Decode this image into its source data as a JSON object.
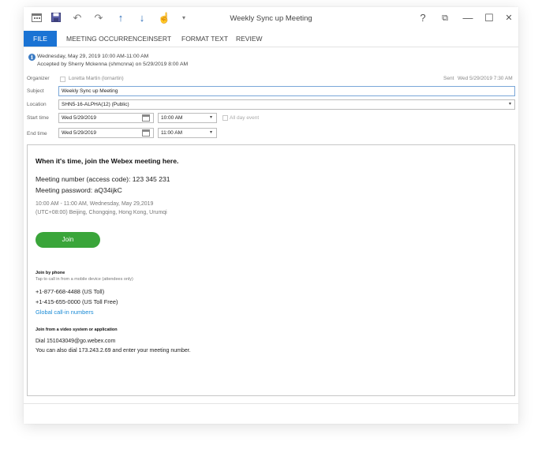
{
  "window": {
    "title": "Weekly Sync up Meeting"
  },
  "qat": {
    "icons": [
      "calendar-icon",
      "save-icon",
      "undo-icon",
      "redo-icon",
      "up-arrow-icon",
      "down-arrow-icon",
      "touch-mode-icon",
      "customize-icon"
    ]
  },
  "controls": {
    "help": "?",
    "ribbon_display": "⧉",
    "minimize": "—",
    "maximize": "☐",
    "close": "✕"
  },
  "ribbon": {
    "tabs": [
      "FILE",
      "MEETING OCCURRENCE",
      "INSERT",
      "FORMAT TEXT",
      "REVIEW"
    ],
    "accent": "#1a73d4"
  },
  "info": {
    "line1": "Wednesday, May 29, 2019 10:00 AM-11:00 AM",
    "line2": "Accepted by Sherry Mckenna (shmcnna) on 5/29/2019 8:00 AM"
  },
  "form": {
    "organizer_label": "Organizer",
    "organizer_value": "Loretta Martin (lornartin)",
    "sent_label": "Sent",
    "sent_value": "Wed 5/29/2019 7:30 AM",
    "subject_label": "Subject",
    "subject_value": "Weekly Sync up Meeting",
    "location_label": "Location",
    "location_value": "SHN5-16-ALPHA(12) (Public)",
    "start_label": "Start time",
    "start_date": "Wed 5/29/2019",
    "start_time": "10:00 AM",
    "all_day_label": "All day event",
    "end_label": "End time",
    "end_date": "Wed 5/29/2019",
    "end_time": "11:00 AM"
  },
  "body": {
    "heading": "When it's time, join the Webex meeting here.",
    "meeting_number": "Meeting number (access code): 123 345 231",
    "meeting_password": "Meeting password: aQ34ijkC",
    "time_line": "10:00 AM - 11:00 AM, Wednesday, May 29,2019",
    "timezone_line": "(UTC+08:00) Beijing, Chongqing, Hong Kong, Urumqi",
    "join_label": "Join",
    "join_color": "#3aa53a",
    "phone_heading": "Join by phone",
    "phone_sub": "Tap to call in from a mobile device (attendees only)",
    "phone_1": "+1-877-668-4488  (US Toll)",
    "phone_2": "+1-415-655-0000  (US Toll Free)",
    "global_link": "Global call-in numbers",
    "video_heading": "Join from a video system or application",
    "video_dial": "Dial 151043049@go.webex.com",
    "video_ip": "You can also dial 173.243.2.69 and enter your meeting number."
  }
}
